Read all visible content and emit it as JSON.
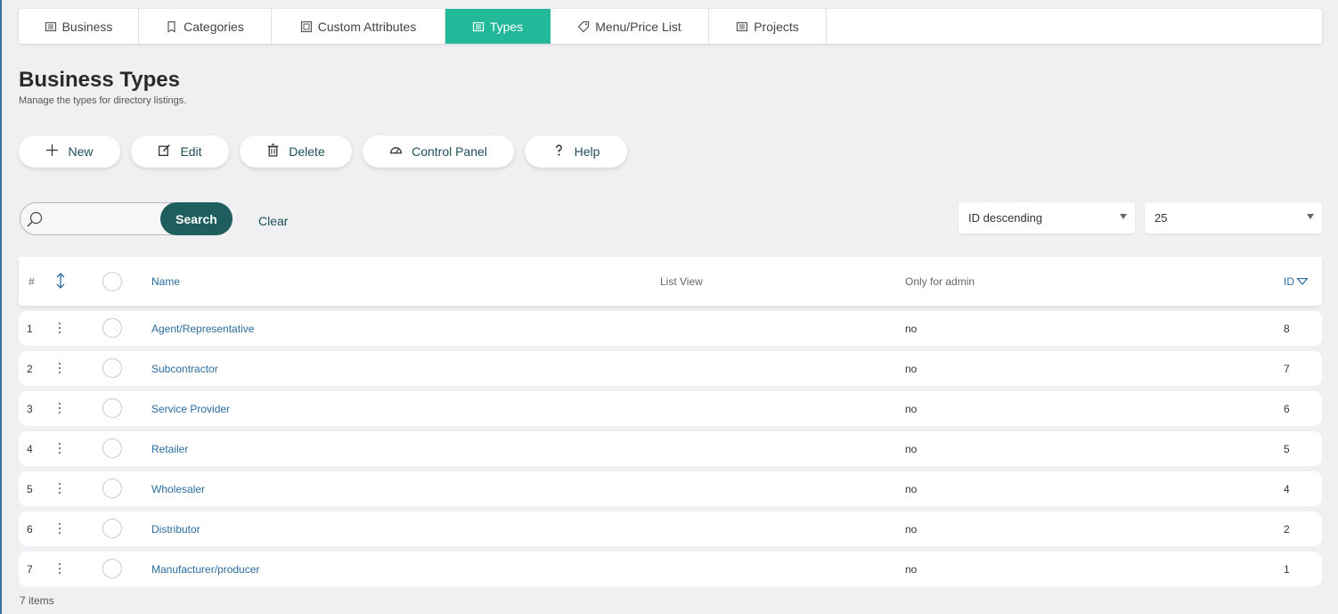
{
  "tabs": [
    {
      "label": "Business",
      "icon": "building-icon",
      "active": false
    },
    {
      "label": "Categories",
      "icon": "book-icon",
      "active": false
    },
    {
      "label": "Custom Attributes",
      "icon": "attributes-icon",
      "active": false
    },
    {
      "label": "Types",
      "icon": "building-icon",
      "active": true
    },
    {
      "label": "Menu/Price List",
      "icon": "tag-icon",
      "active": false
    },
    {
      "label": "Projects",
      "icon": "building-icon",
      "active": false
    }
  ],
  "page": {
    "title": "Business Types",
    "subtitle": "Manage the types for directory listings."
  },
  "toolbar": {
    "new_label": "New",
    "edit_label": "Edit",
    "delete_label": "Delete",
    "control_panel_label": "Control Panel",
    "help_label": "Help"
  },
  "search": {
    "value": "",
    "button_label": "Search",
    "clear_label": "Clear"
  },
  "sort_select": {
    "value": "ID descending"
  },
  "page_size_select": {
    "value": "25"
  },
  "table": {
    "headers": {
      "index": "#",
      "name": "Name",
      "list_view": "List View",
      "only_admin": "Only for admin",
      "id": "ID"
    },
    "rows": [
      {
        "index": "1",
        "name": "Agent/Representative",
        "list_view": "",
        "only_admin": "no",
        "id": "8"
      },
      {
        "index": "2",
        "name": "Subcontractor",
        "list_view": "",
        "only_admin": "no",
        "id": "7"
      },
      {
        "index": "3",
        "name": "Service Provider",
        "list_view": "",
        "only_admin": "no",
        "id": "6"
      },
      {
        "index": "4",
        "name": "Retailer",
        "list_view": "",
        "only_admin": "no",
        "id": "5"
      },
      {
        "index": "5",
        "name": "Wholesaler",
        "list_view": "",
        "only_admin": "no",
        "id": "4"
      },
      {
        "index": "6",
        "name": "Distributor",
        "list_view": "",
        "only_admin": "no",
        "id": "2"
      },
      {
        "index": "7",
        "name": "Manufacturer/producer",
        "list_view": "",
        "only_admin": "no",
        "id": "1"
      }
    ]
  },
  "footer": {
    "count_text": "7 items"
  },
  "colors": {
    "accent": "#22b99a",
    "primary_dark": "#1e5e5e",
    "link": "#2a6c9c"
  }
}
